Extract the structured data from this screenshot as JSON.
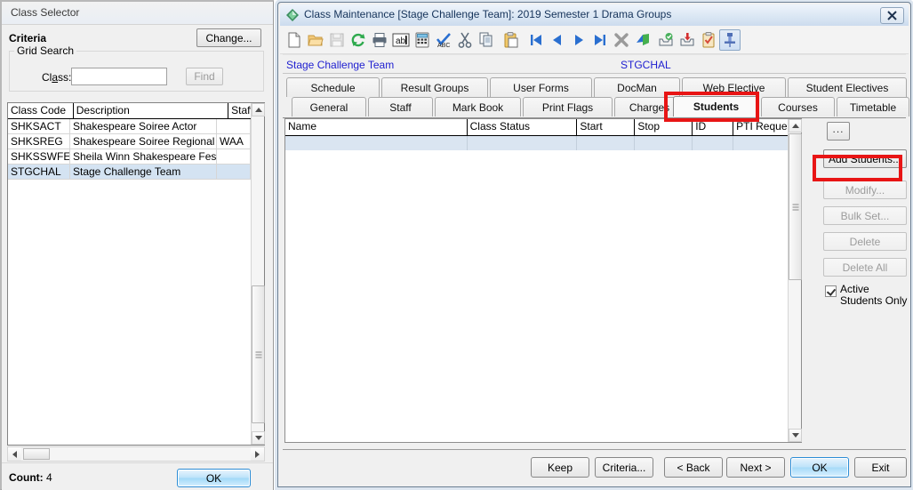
{
  "class_selector": {
    "title": "Class Selector",
    "criteria_label": "Criteria",
    "change_button": "Change...",
    "grid_search_legend": "Grid Search",
    "class_label": "Class:",
    "class_input_value": "",
    "class_input_placeholder": "",
    "find_button": "Find",
    "columns": [
      "Class Code",
      "Description",
      "Staff"
    ],
    "rows": [
      {
        "code": "SHKSACT",
        "description": "Shakespeare Soiree Actor",
        "staff": "",
        "selected": false
      },
      {
        "code": "SHKSREG",
        "description": "Shakespeare Soiree Regional",
        "staff": "WAA",
        "selected": false
      },
      {
        "code": "SHKSSWFEST",
        "description": "Sheila Winn Shakespeare Festival",
        "staff": "",
        "selected": false
      },
      {
        "code": "STGCHAL",
        "description": "Stage Challenge Team",
        "staff": "",
        "selected": true
      }
    ],
    "count_label": "Count:",
    "count_value": "4",
    "ok_button": "OK"
  },
  "class_maintenance": {
    "title": "Class Maintenance  [Stage Challenge Team]:  2019 Semester 1 Drama Groups",
    "close_button": "✖",
    "toolbar": [
      {
        "name": "new-icon",
        "tip": "New"
      },
      {
        "name": "open-folder-icon",
        "tip": "Open"
      },
      {
        "name": "save-icon",
        "tip": "Save"
      },
      {
        "name": "refresh-icon",
        "tip": "Refresh"
      },
      {
        "name": "print-icon",
        "tip": "Print"
      },
      {
        "name": "abl-label-icon",
        "tip": "Labels"
      },
      {
        "name": "calculator-icon",
        "tip": "Calculator"
      },
      {
        "name": "spellcheck-icon",
        "tip": "Spell Check"
      },
      {
        "name": "cut-icon",
        "tip": "Cut"
      },
      {
        "name": "copy-icon",
        "tip": "Copy"
      },
      {
        "name": "paste-icon",
        "tip": "Paste"
      },
      {
        "name": "first-record-icon",
        "tip": "First"
      },
      {
        "name": "previous-record-icon",
        "tip": "Previous"
      },
      {
        "name": "next-record-icon",
        "tip": "Next"
      },
      {
        "name": "last-record-icon",
        "tip": "Last"
      },
      {
        "name": "delete-record-icon",
        "tip": "Delete"
      },
      {
        "name": "export-icon",
        "tip": "Export"
      },
      {
        "name": "inbox-check-icon",
        "tip": "Check In"
      },
      {
        "name": "inbox-down-icon",
        "tip": "Check Out"
      },
      {
        "name": "clipboard-check-icon",
        "tip": "Tasks"
      },
      {
        "name": "pin-icon",
        "tip": "Pin"
      }
    ],
    "header": {
      "class_name": "Stage Challenge Team",
      "class_code": "STGCHAL"
    },
    "tabs_row1": [
      {
        "label": "Schedule",
        "active": false
      },
      {
        "label": "Result Groups",
        "active": false
      },
      {
        "label": "User Forms",
        "active": false
      },
      {
        "label": "DocMan",
        "active": false
      },
      {
        "label": "Web Elective",
        "active": false
      },
      {
        "label": "Student Electives",
        "active": false
      }
    ],
    "tabs_row2": [
      {
        "label": "General",
        "active": false
      },
      {
        "label": "Staff",
        "active": false
      },
      {
        "label": "Mark Book",
        "active": false
      },
      {
        "label": "Print Flags",
        "active": false
      },
      {
        "label": "Charges",
        "active": false
      },
      {
        "label": "Students",
        "active": true
      },
      {
        "label": "Courses",
        "active": false
      },
      {
        "label": "Timetable",
        "active": false
      }
    ],
    "students_grid": {
      "columns": [
        "Name",
        "Class Status",
        "Start",
        "Stop",
        "ID",
        "PTI Request"
      ],
      "rows": []
    },
    "side_buttons": [
      {
        "label": "...",
        "enabled": true,
        "name": "more-options-button"
      },
      {
        "label": "Add Students...",
        "enabled": true,
        "name": "add-students-button"
      },
      {
        "label": "Modify...",
        "enabled": false,
        "name": "modify-button"
      },
      {
        "label": "Bulk Set...",
        "enabled": false,
        "name": "bulk-set-button"
      },
      {
        "label": "Delete",
        "enabled": false,
        "name": "delete-button"
      },
      {
        "label": "Delete All",
        "enabled": false,
        "name": "delete-all-button"
      }
    ],
    "active_students_checkbox": {
      "label_line1": "Active",
      "label_line2": "Students Only",
      "checked": true
    },
    "bottom_buttons": [
      {
        "label": "Keep",
        "primary": false,
        "name": "keep-button"
      },
      {
        "label": "Criteria...",
        "primary": false,
        "name": "criteria-button"
      },
      {
        "label": "< Back",
        "primary": false,
        "name": "back-button"
      },
      {
        "label": "Next >",
        "primary": false,
        "name": "next-button"
      },
      {
        "label": "OK",
        "primary": true,
        "name": "ok-button"
      },
      {
        "label": "Exit",
        "primary": false,
        "name": "exit-button"
      }
    ]
  },
  "annotations": {
    "highlight_color": "#e81515",
    "boxes": [
      "students-tab-highlight",
      "add-students-button-highlight"
    ]
  }
}
